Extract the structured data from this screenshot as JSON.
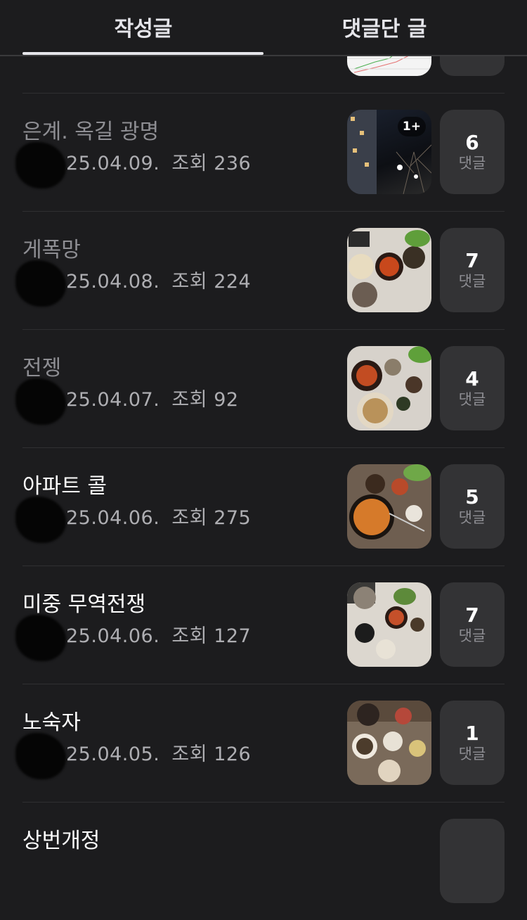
{
  "tabs": [
    {
      "label": "작성글",
      "active": true
    },
    {
      "label": "댓글단 글",
      "active": false
    }
  ],
  "comment_label": "댓글",
  "posts": [
    {
      "title": "",
      "date": "",
      "views": "",
      "comments": ""
    },
    {
      "title": "은계. 옥길 광명",
      "date": "25.04.09.",
      "views_label": "조회",
      "views": "236",
      "comments": "6",
      "badge": "1+",
      "dim": true
    },
    {
      "title": "게폭망",
      "date": "25.04.08.",
      "views_label": "조회",
      "views": "224",
      "comments": "7",
      "dim": true
    },
    {
      "title": "전젱",
      "date": "25.04.07.",
      "views_label": "조회",
      "views": "92",
      "comments": "4",
      "dim": true
    },
    {
      "title": "아파트 콜",
      "date": "25.04.06.",
      "views_label": "조회",
      "views": "275",
      "comments": "5",
      "dim": false
    },
    {
      "title": "미중 무역전쟁",
      "date": "25.04.06.",
      "views_label": "조회",
      "views": "127",
      "comments": "7",
      "dim": false
    },
    {
      "title": "노숙자",
      "date": "25.04.05.",
      "views_label": "조회",
      "views": "126",
      "comments": "1",
      "dim": false
    },
    {
      "title": "상번개정",
      "date": "",
      "views_label": "",
      "views": "",
      "comments": "",
      "dim": false
    }
  ]
}
